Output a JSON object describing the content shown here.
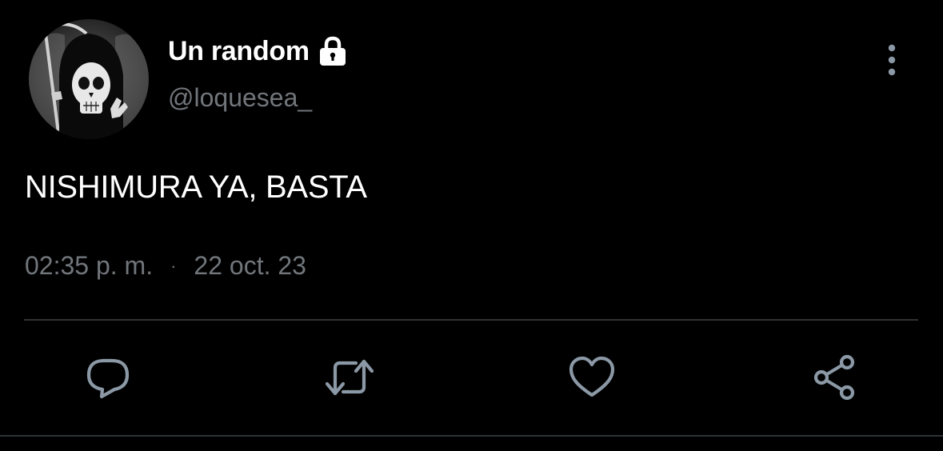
{
  "author": {
    "display_name": "Un random",
    "handle": "@loquesea_",
    "avatar_icon": "skull-reaper-avatar",
    "protected_icon": "lock-icon"
  },
  "tweet": {
    "text": "NISHIMURA YA, BASTA",
    "time": "02:35 p. m.",
    "separator": "·",
    "date": "22 oct. 23"
  },
  "actions": [
    {
      "name": "reply",
      "icon": "reply-icon"
    },
    {
      "name": "retweet",
      "icon": "retweet-icon"
    },
    {
      "name": "like",
      "icon": "heart-icon"
    },
    {
      "name": "share",
      "icon": "share-icon"
    }
  ],
  "colors": {
    "background": "#000000",
    "primary_text": "#ffffff",
    "secondary_text": "#71767b",
    "divider": "#2f3336"
  }
}
